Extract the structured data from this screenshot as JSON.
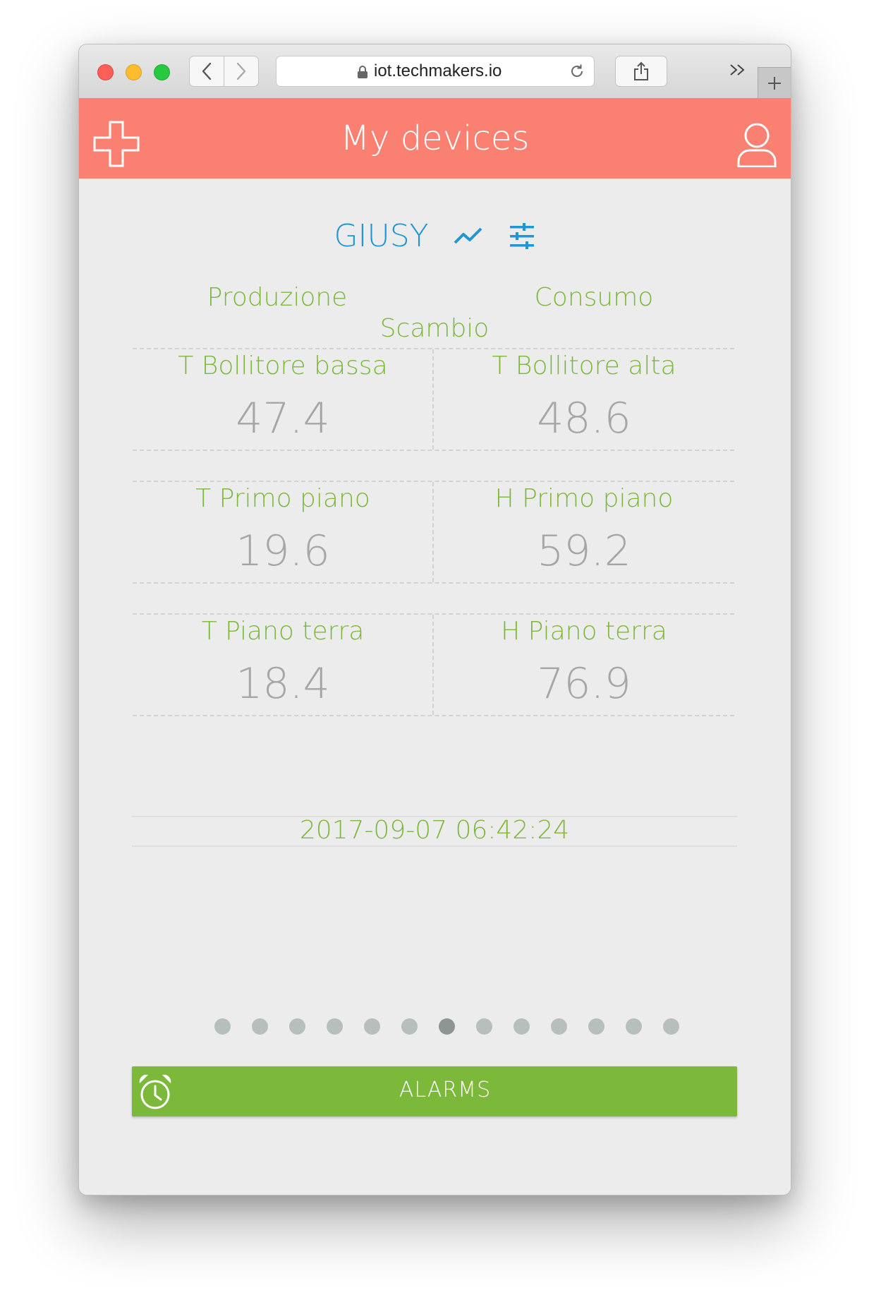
{
  "browser": {
    "url": "iot.techmakers.io"
  },
  "header": {
    "title": "My devices"
  },
  "device": {
    "name": "GIUSY"
  },
  "tabs": [
    "Produzione",
    "Consumo",
    "Scambio"
  ],
  "metrics": [
    {
      "label": "T Bollitore bassa",
      "value": "47.4"
    },
    {
      "label": "T Bollitore alta",
      "value": "48.6"
    },
    {
      "label": "T Primo piano",
      "value": "19.6"
    },
    {
      "label": "H Primo piano",
      "value": "59.2"
    },
    {
      "label": "T Piano terra",
      "value": "18.4"
    },
    {
      "label": "H Piano terra",
      "value": "76.9"
    }
  ],
  "timestamp": "2017-09-07 06:42:24",
  "pagination": {
    "total": 13,
    "active_index": 6
  },
  "alarms": {
    "label": "ALARMS"
  },
  "colors": {
    "header_bg": "#fa8072",
    "accent_blue": "#2296d3",
    "accent_green": "#7cb83a",
    "value_gray": "#a6a6a6"
  }
}
